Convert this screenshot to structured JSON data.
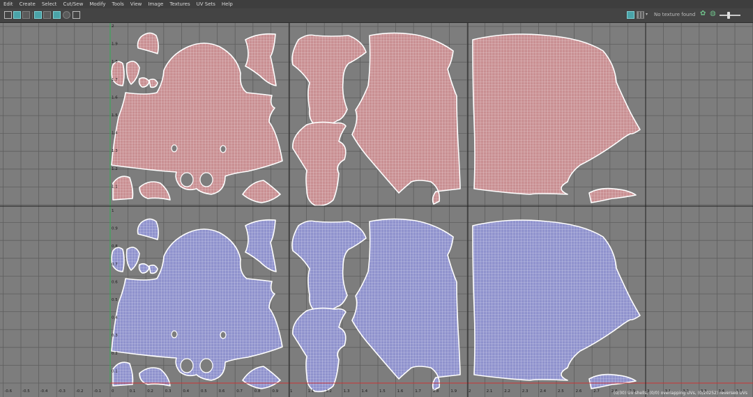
{
  "menu": [
    "Edit",
    "Create",
    "Select",
    "Cut/Sew",
    "Modify",
    "Tools",
    "View",
    "Image",
    "Textures",
    "UV Sets",
    "Help"
  ],
  "toolbar": {
    "texture_status": "No texture found",
    "icons": [
      "uv-toolkit-icon",
      "texture-toggle-icon",
      "shaded-icon",
      "wireframe-icon",
      "checker-icon",
      "grid-icon",
      "pixel-snap-icon",
      "image-display-icon",
      "checker-grid-icon",
      "dropdown-icon",
      "display-settings-icon",
      "swatch-icon",
      "exposure-icon",
      "gamma-slider"
    ]
  },
  "grid": {
    "bottom_axis": [
      "-0.6",
      "-0.5",
      "-0.4",
      "-0.3",
      "-0.2",
      "-0.1",
      "0",
      "0.1",
      "0.2",
      "0.3",
      "0.4",
      "0.5",
      "0.6",
      "0.7",
      "0.8",
      "0.9",
      "1",
      "1.1",
      "1.2",
      "1.3",
      "1.4",
      "1.5",
      "1.6",
      "1.7",
      "1.8",
      "1.9",
      "2",
      "2.1",
      "2.2",
      "2.3",
      "2.4",
      "2.5",
      "2.6",
      "2.7",
      "2.8",
      "2.9",
      "3",
      "3.1",
      "3.2",
      "3.3",
      "3.4",
      "3.5"
    ],
    "left_axis_upper": [
      "2",
      "1.9",
      "1.8",
      "1.7",
      "1.6",
      "1.5",
      "1.4",
      "1.3",
      "1.2",
      "1.1"
    ],
    "left_axis_lower": [
      "1",
      "0.9",
      "0.8",
      "0.7",
      "0.6",
      "0.5",
      "0.4",
      "0.3",
      "0.2",
      "0.1"
    ]
  },
  "colors": {
    "viewport": "#7d7d7d",
    "upper_shells": "#c98f92",
    "lower_shells": "#8f92cd",
    "shell_edge": "#ffffff"
  },
  "status": "(0/30) UV shells, (0/0) overlapping UVs, (0/20252) reversed UVs"
}
